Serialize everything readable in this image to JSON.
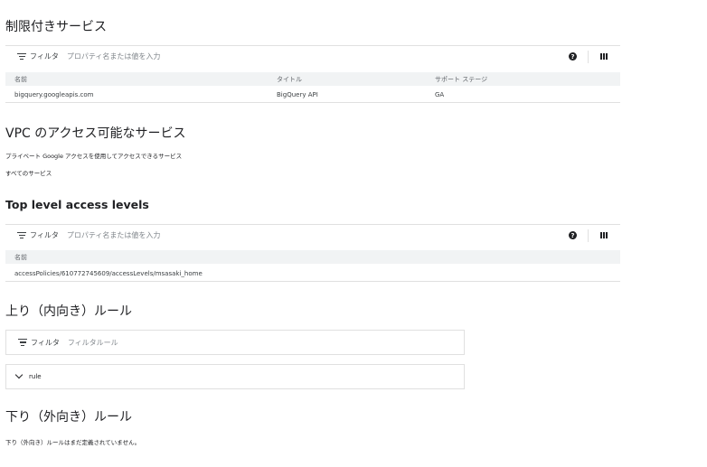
{
  "restricted": {
    "title": "制限付きサービス",
    "filter_label": "フィルタ",
    "filter_placeholder": "プロパティ名または値を入力",
    "columns": [
      "名前",
      "タイトル",
      "サポート ステージ"
    ],
    "rows": [
      [
        "bigquery.googleapis.com",
        "BigQuery API",
        "GA"
      ]
    ]
  },
  "vpc": {
    "title": "VPC のアクセス可能なサービス",
    "line1": "プライベート Google アクセスを使用してアクセスできるサービス",
    "line2": "すべてのサービス"
  },
  "access_levels": {
    "title": "Top level access levels",
    "filter_label": "フィルタ",
    "filter_placeholder": "プロパティ名または値を入力",
    "columns": [
      "名前"
    ],
    "rows": [
      [
        "accessPolicies/610772745609/accessLevels/msasaki_home"
      ]
    ]
  },
  "ingress": {
    "title": "上り（内向き）ルール",
    "filter_label": "フィルタ",
    "filter_placeholder": "フィルタルール",
    "rule_label": "rule"
  },
  "egress": {
    "title": "下り（外向き）ルール",
    "note": "下り（外向き）ルールはまだ定義されていません。"
  },
  "icons": {
    "filter": "filter-icon",
    "help": "help-icon",
    "columns": "column-display-icon",
    "chevron": "chevron-down-icon"
  }
}
